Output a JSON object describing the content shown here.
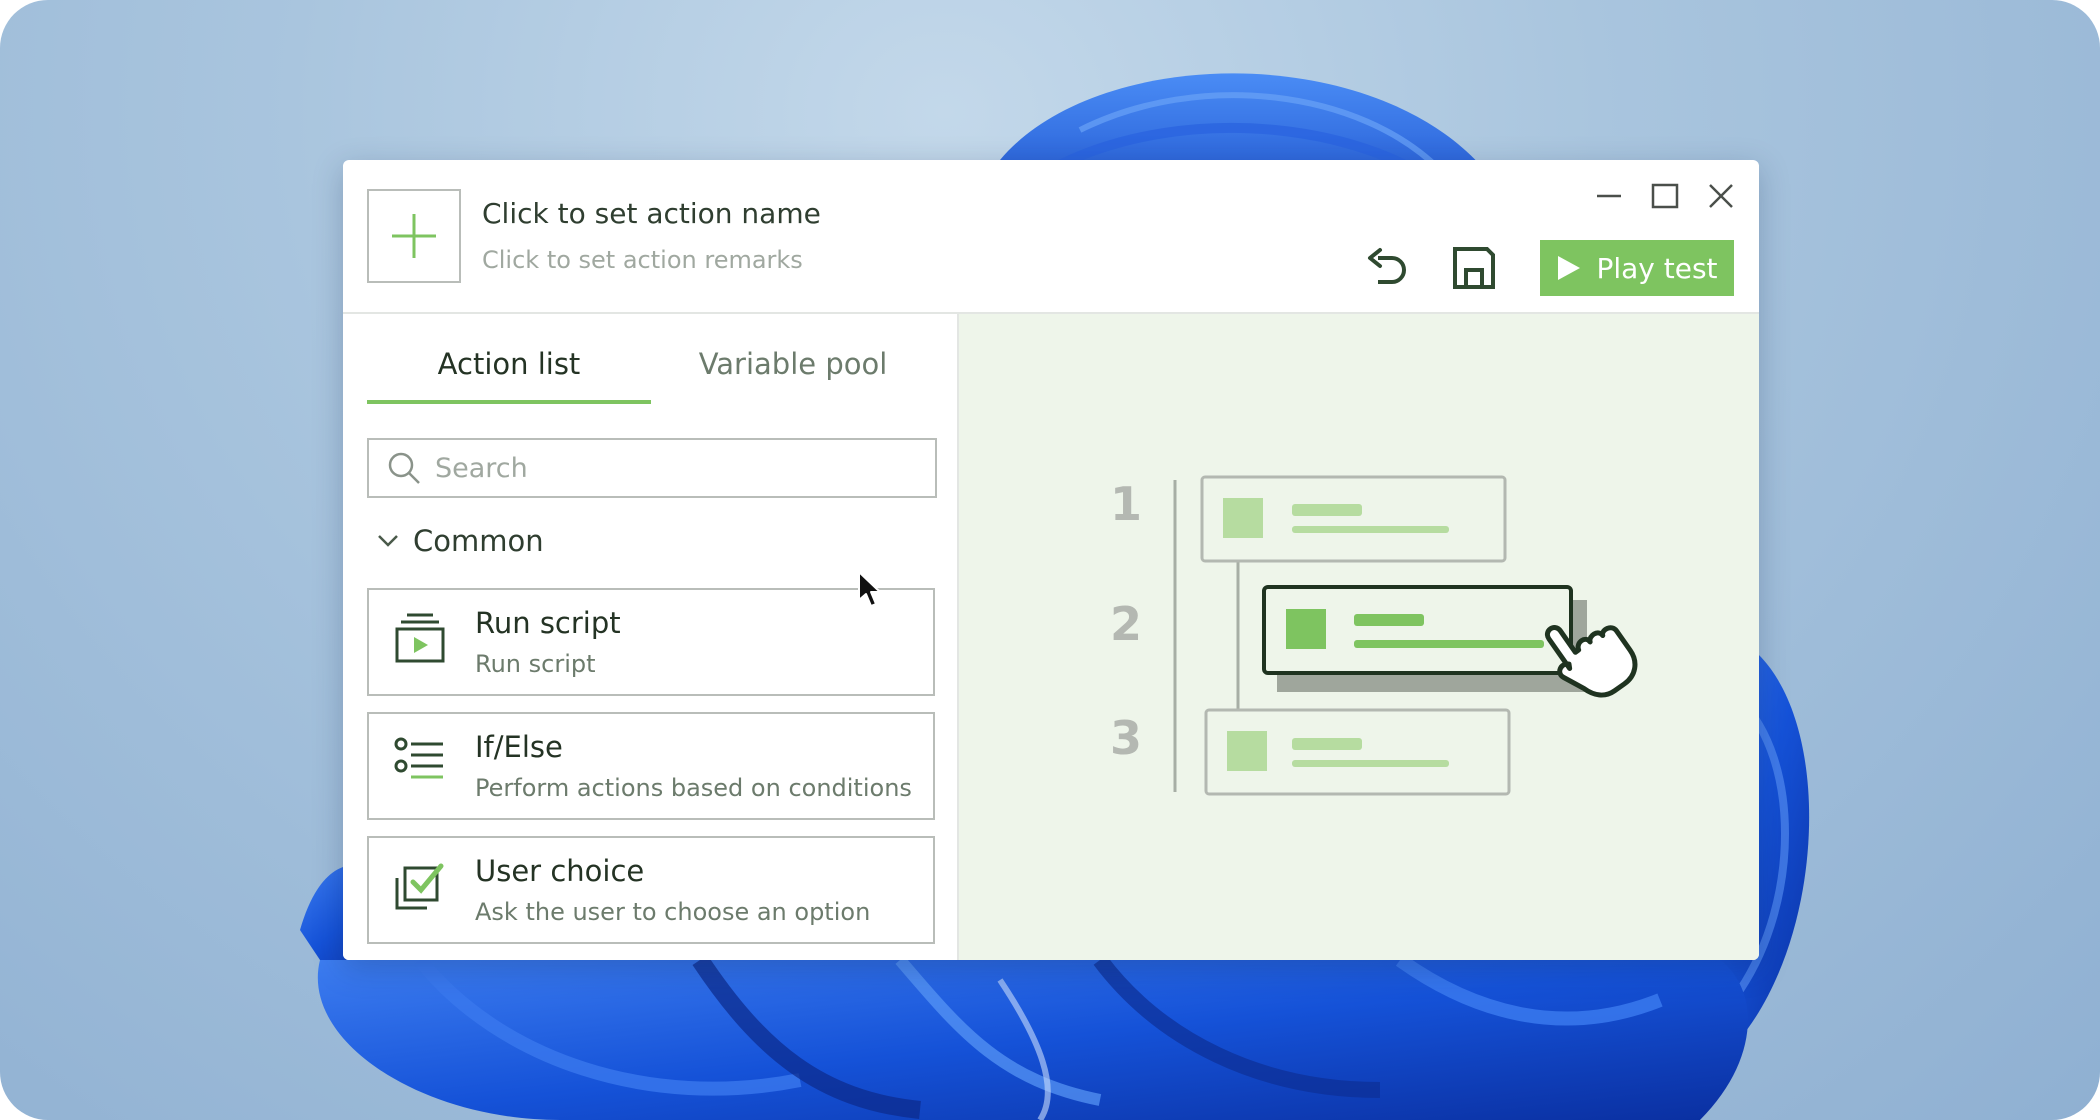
{
  "header": {
    "action_name": "Click to set action name",
    "action_remarks": "Click to set action remarks",
    "play_label": "Play test"
  },
  "tabs": [
    {
      "label": "Action list",
      "active": true
    },
    {
      "label": "Variable pool",
      "active": false
    }
  ],
  "search": {
    "placeholder": "Search",
    "value": ""
  },
  "group": {
    "label": "Common",
    "expanded": true
  },
  "actions": [
    {
      "title": "Run script",
      "description": "Run script",
      "icon": "run-script-icon"
    },
    {
      "title": "If/Else",
      "description": "Perform actions based on conditions",
      "icon": "if-else-icon"
    },
    {
      "title": "User choice",
      "description": "Ask the user to choose an option",
      "icon": "user-choice-icon"
    }
  ],
  "illustration": {
    "step_numbers": [
      "1",
      "2",
      "3"
    ]
  },
  "colors": {
    "accent": "#7ec460",
    "illustration_bg": "#eef5ea",
    "dark_icon": "#2f4a30"
  }
}
